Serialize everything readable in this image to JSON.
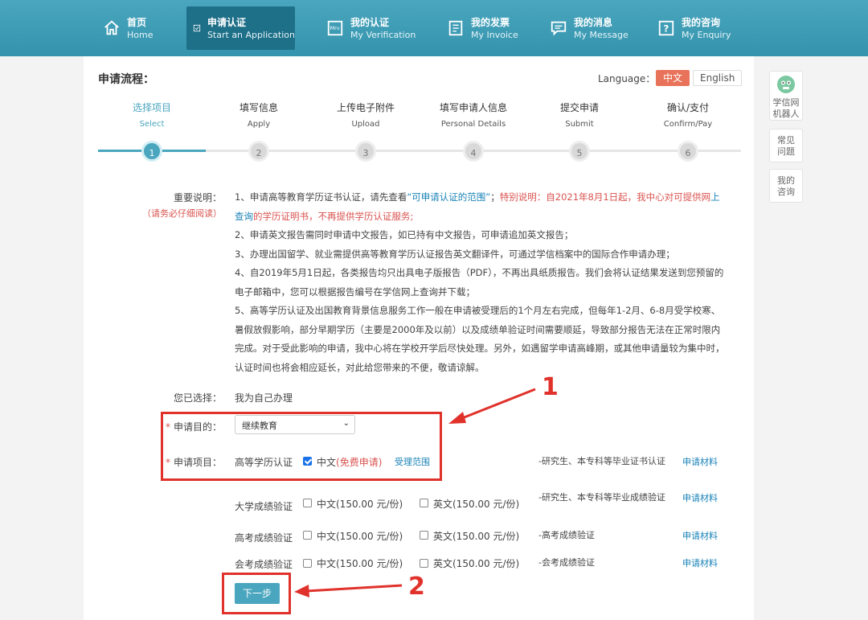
{
  "nav": [
    {
      "cn": "首页",
      "en": "Home",
      "icon": "home-icon"
    },
    {
      "cn": "申请认证",
      "en": "Start an Application",
      "icon": "checkbox-icon"
    },
    {
      "cn": "我的认证",
      "en": "My Verification",
      "icon": "verification-icon"
    },
    {
      "cn": "我的发票",
      "en": "My Invoice",
      "icon": "invoice-icon"
    },
    {
      "cn": "我的消息",
      "en": "My Message",
      "icon": "message-icon"
    },
    {
      "cn": "我的咨询",
      "en": "My Enquiry",
      "icon": "enquiry-icon"
    }
  ],
  "header": {
    "title": "申请流程：",
    "language_label": "Language：",
    "lang_cn": "中文",
    "lang_en": "English"
  },
  "steps": [
    {
      "cn": "选择项目",
      "en": "Select",
      "num": "1"
    },
    {
      "cn": "填写信息",
      "en": "Apply",
      "num": "2"
    },
    {
      "cn": "上传电子附件",
      "en": "Upload",
      "num": "3"
    },
    {
      "cn": "填写申请人信息",
      "en": "Personal Details",
      "num": "4"
    },
    {
      "cn": "提交申请",
      "en": "Submit",
      "num": "5"
    },
    {
      "cn": "确认/支付",
      "en": "Confirm/Pay",
      "num": "6"
    }
  ],
  "notes": {
    "label": "重要说明：",
    "sub": "（请务必仔细阅读）",
    "n1_a": "1、申请高等教育学历证书认证，请先查看",
    "n1_link": "“可申请认证的范围”",
    "n1_b": "；",
    "n1_red1": "特别说明：自2021年8月1日起，我中心对可提供网",
    "n1_link2": "上查询",
    "n1_red2": "的学历证明书，不再提供学历认证服务;",
    "n2": "2、申请英文报告需同时申请中文报告，如已持有中文报告，可申请追加英文报告；",
    "n3": "3、办理出国留学、就业需提供高等教育学历认证报告英文翻译件，可通过学信档案中的国际合作申请办理；",
    "n4": "4、自2019年5月1日起，各类报告均只出具电子版报告（PDF），不再出具纸质报告。我们会将认证结果发送到您预留的电子邮箱中，您可以根据报告编号在学信网上查询并下载；",
    "n5": "5、高等学历认证及出国教育背景信息服务工作一般在申请被受理后的1个月左右完成，但每年1-2月、6-8月受学校寒、暑假放假影响，部分早期学历（主要是2000年及以前）以及成绩单验证时间需要顺延，导致部分报告无法在正常时限内完成。对于受此影响的申请，我中心将在学校开学后尽快处理。另外，如遇留学申请高峰期，或其他申请量较为集中时，认证时间也将会相应延长，对此给您带来的不便，敬请谅解。"
  },
  "form": {
    "chosen_label": "您已选择：",
    "chosen_value": "我为自己办理",
    "purpose_label": "申请目的：",
    "purpose_value": "继续教育",
    "item_label": "申请项目：",
    "required_mark": "*",
    "rows": [
      {
        "name": "高等学历认证",
        "cn_opt": "中文",
        "cn_free": "(免费申请)",
        "scope": "受理范围",
        "desc": "-研究生、本专科等毕业证书认证",
        "material": "申请材料"
      },
      {
        "name": "大学成绩验证",
        "cn_opt": "中文(150.00 元/份)",
        "en_opt": "英文(150.00 元/份)",
        "desc": "-研究生、本专科等毕业成绩验证",
        "material": "申请材料"
      },
      {
        "name": "高考成绩验证",
        "cn_opt": "中文(150.00 元/份)",
        "en_opt": "英文(150.00 元/份)",
        "desc": "-高考成绩验证",
        "material": "申请材料"
      },
      {
        "name": "会考成绩验证",
        "cn_opt": "中文(150.00 元/份)",
        "en_opt": "英文(150.00 元/份)",
        "desc": "-会考成绩验证",
        "material": "申请材料"
      }
    ],
    "next": "下一步"
  },
  "annotations": {
    "one": "1",
    "two": "2"
  },
  "sidebar": {
    "robot": "学信网机器人",
    "faq": "常见问题",
    "enquiry": "我的咨询"
  },
  "colors": {
    "nav": "#3a9bb5",
    "accent": "#4aa6be",
    "annotation": "#e0322b",
    "lang_active": "#e8735a"
  }
}
